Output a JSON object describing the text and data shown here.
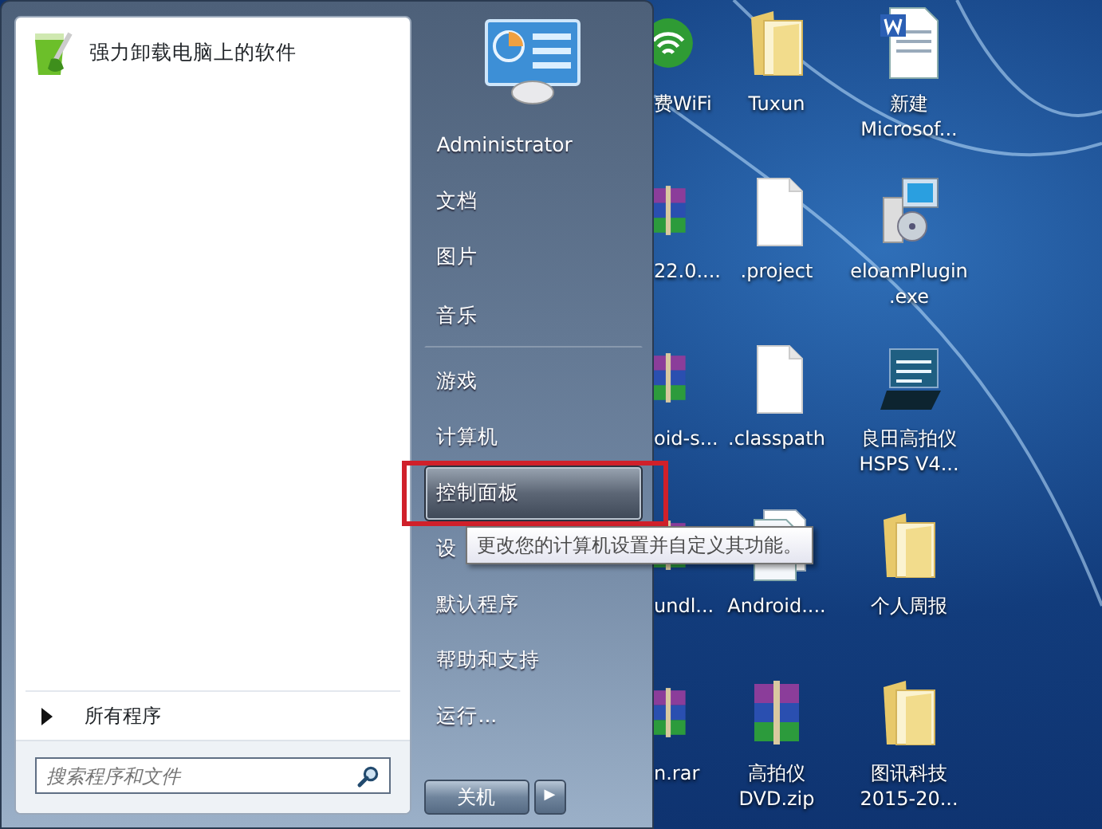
{
  "desktop_icons": [
    {
      "lines": [
        "费WiFi"
      ],
      "kind": "wifi"
    },
    {
      "lines": [
        "Tuxun"
      ],
      "kind": "folder"
    },
    {
      "lines": [
        "新建",
        "Microsof..."
      ],
      "kind": "word"
    },
    {
      "lines": [
        "22.0...."
      ],
      "kind": "archive"
    },
    {
      "lines": [
        ".project"
      ],
      "kind": "file"
    },
    {
      "lines": [
        "eloamPlugin",
        ".exe"
      ],
      "kind": "installer"
    },
    {
      "lines": [
        "oid-s..."
      ],
      "kind": "archive"
    },
    {
      "lines": [
        ".classpath"
      ],
      "kind": "file"
    },
    {
      "lines": [
        "良田高拍仪",
        "HSPS V4..."
      ],
      "kind": "app"
    },
    {
      "lines": [
        "undl..."
      ],
      "kind": "archive"
    },
    {
      "lines": [
        "Android...."
      ],
      "kind": "document"
    },
    {
      "lines": [
        "个人周报"
      ],
      "kind": "folder"
    },
    {
      "lines": [
        "n.rar"
      ],
      "kind": "archive"
    },
    {
      "lines": [
        "高拍仪",
        "DVD.zip"
      ],
      "kind": "archive"
    },
    {
      "lines": [
        "图讯科技",
        "2015-20..."
      ],
      "kind": "folder"
    }
  ],
  "start_menu": {
    "pinned_programs": [
      {
        "label": "强力卸载电脑上的软件"
      }
    ],
    "all_programs": "所有程序",
    "search": {
      "placeholder": "搜索程序和文件"
    },
    "right_items": [
      {
        "label": "Administrator",
        "selected": false,
        "annotated": false,
        "separator_after": false
      },
      {
        "label": "文档",
        "selected": false,
        "annotated": false,
        "separator_after": false
      },
      {
        "label": "图片",
        "selected": false,
        "annotated": false,
        "separator_after": false
      },
      {
        "label": "音乐",
        "selected": false,
        "annotated": false,
        "separator_after": true
      },
      {
        "label": "游戏",
        "selected": false,
        "annotated": false,
        "separator_after": false
      },
      {
        "label": "计算机",
        "selected": false,
        "annotated": false,
        "separator_after": false
      },
      {
        "label": "控制面板",
        "selected": true,
        "annotated": true,
        "separator_after": false
      },
      {
        "label": "设",
        "selected": false,
        "annotated": false,
        "separator_after": false
      },
      {
        "label": "默认程序",
        "selected": false,
        "annotated": false,
        "separator_after": false
      },
      {
        "label": "帮助和支持",
        "selected": false,
        "annotated": false,
        "separator_after": false
      },
      {
        "label": "运行...",
        "selected": false,
        "annotated": false,
        "separator_after": false
      }
    ],
    "shutdown": "关机",
    "shutdown_arrow": "▶",
    "tooltip": "更改您的计算机设置并自定义其功能。"
  }
}
